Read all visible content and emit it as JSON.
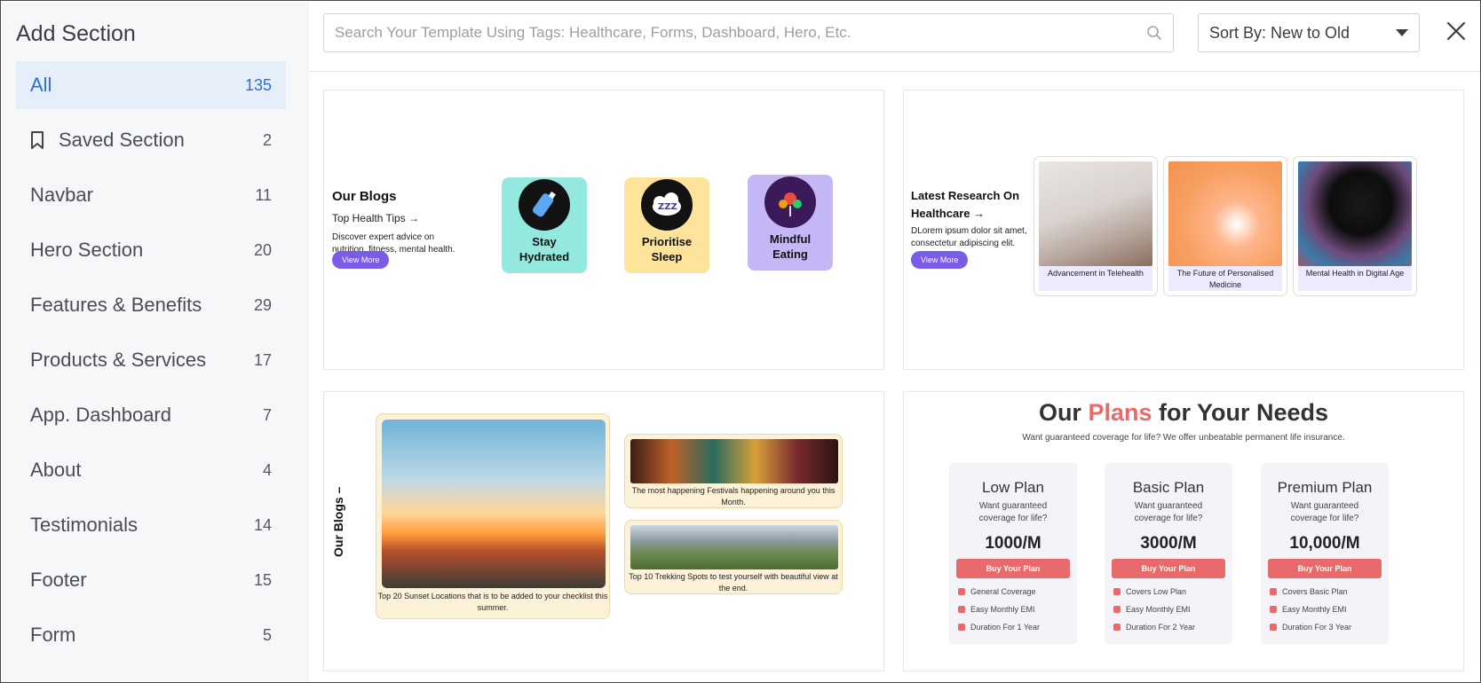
{
  "sidebar": {
    "title": "Add Section",
    "items": [
      {
        "label": "All",
        "count": "135"
      },
      {
        "label": "Saved Section",
        "count": "2"
      },
      {
        "label": "Navbar",
        "count": "11"
      },
      {
        "label": "Hero Section",
        "count": "20"
      },
      {
        "label": "Features & Benefits",
        "count": "29"
      },
      {
        "label": "Products & Services",
        "count": "17"
      },
      {
        "label": "App. Dashboard",
        "count": "7"
      },
      {
        "label": "About",
        "count": "4"
      },
      {
        "label": "Testimonials",
        "count": "14"
      },
      {
        "label": "Footer",
        "count": "15"
      },
      {
        "label": "Form",
        "count": "5"
      }
    ]
  },
  "topbar": {
    "search_placeholder": "Search Your Template Using Tags: Healthcare, Forms, Dashboard, Hero, Etc.",
    "sort_label": "Sort By: New to Old"
  },
  "templates": {
    "blogs": {
      "title": "Our Blogs",
      "subtitle": "Top Health Tips →",
      "description": "Discover expert advice on nutrition, fitness, mental health.",
      "button": "View More",
      "tiles": [
        {
          "title": "Stay Hydrated",
          "color": "#93e9dd"
        },
        {
          "title": "Prioritise Sleep",
          "color": "#fde49a"
        },
        {
          "title": "Mindful Eating",
          "color": "#c5b6f6"
        }
      ]
    },
    "research": {
      "title": "Latest Research On Healthcare →",
      "description": "DLorem ipsum dolor sit amet, consectetur adipiscing elit.",
      "button": "View More",
      "cards": [
        {
          "caption": "Advancement in Telehealth"
        },
        {
          "caption": "The Future of Personalised Medicine"
        },
        {
          "caption": "Mental Health in Digital Age"
        }
      ]
    },
    "blogs2": {
      "title": "Our Blogs –",
      "main_caption": "Top 20 Sunset Locations that is to be added to your checklist this summer.",
      "side_captions": [
        "The most happening Festivals happening around you this Month.",
        "Top 10 Trekking Spots to test yourself with beautiful view at the end."
      ]
    },
    "plans": {
      "title_pre": "Our ",
      "title_accent": "Plans",
      "title_post": " for Your Needs",
      "subtitle": "Want guaranteed coverage for life? We offer unbeatable permanent life insurance.",
      "accent_color": "#e86a6a",
      "items": [
        {
          "name": "Low Plan",
          "desc": "Want guaranteed coverage for life?",
          "price": "1000/M",
          "button": "Buy Your Plan",
          "features": [
            "General Coverage",
            "Easy Monthly EMI",
            "Duration For 1 Year"
          ]
        },
        {
          "name": "Basic Plan",
          "desc": "Want guaranteed coverage for life?",
          "price": "3000/M",
          "button": "Buy Your Plan",
          "features": [
            "Covers Low Plan",
            "Easy Monthly EMI",
            "Duration For 2 Year"
          ]
        },
        {
          "name": "Premium Plan",
          "desc": "Want guaranteed coverage for life?",
          "price": "10,000/M",
          "button": "Buy Your Plan",
          "features": [
            "Covers Basic Plan",
            "Easy Monthly EMI",
            "Duration For 3 Year"
          ]
        }
      ]
    }
  }
}
